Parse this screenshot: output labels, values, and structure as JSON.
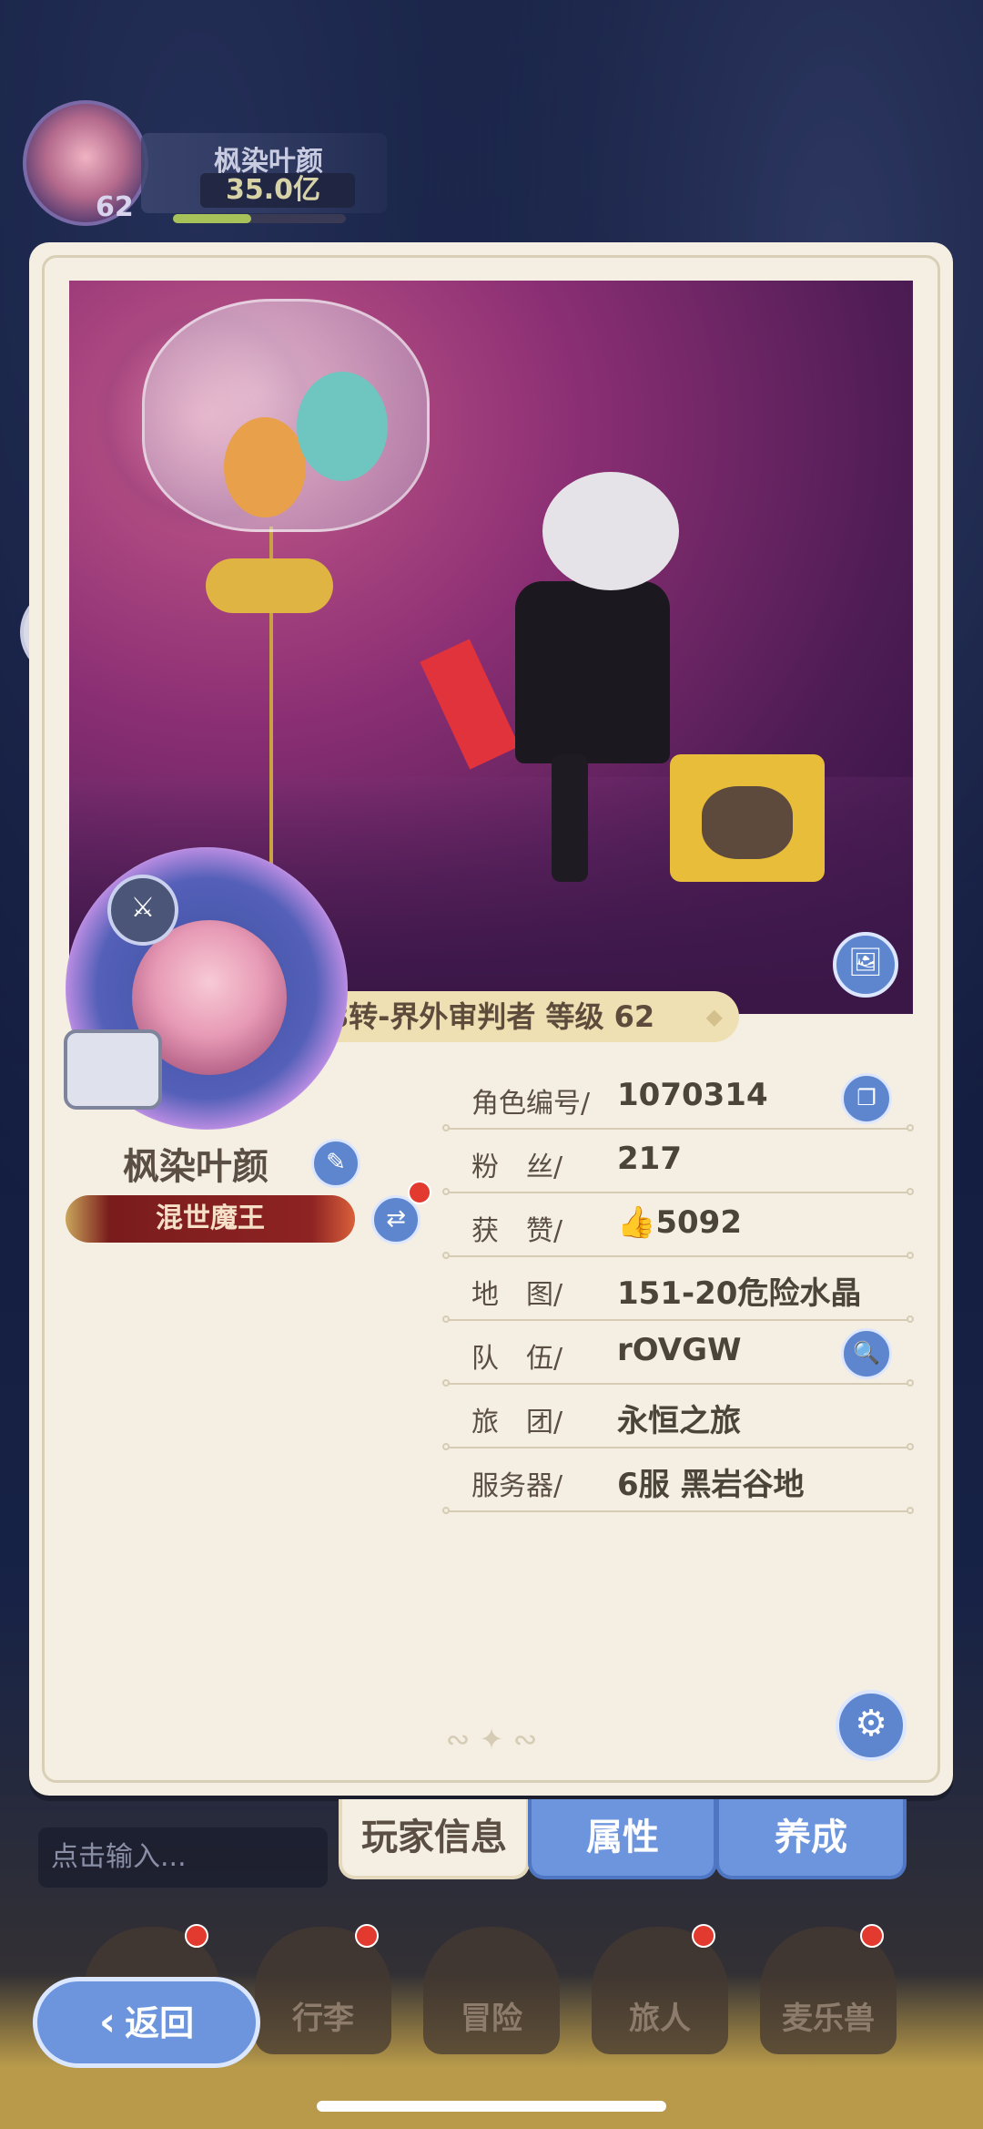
{
  "hud": {
    "name": "枫染叶颜",
    "power": "35.0亿",
    "level": "62",
    "exp_fraction": 0.45
  },
  "profile": {
    "class_banner": "8转-界外审判者 等级 62",
    "player_name": "枫染叶颜",
    "title_badge": "混世魔王"
  },
  "info": {
    "rows": [
      {
        "label": "角色编号/",
        "value": "1070314"
      },
      {
        "label": "粉　丝/",
        "value": "217"
      },
      {
        "label": "获　赞/",
        "value": "5092"
      },
      {
        "label": "地　图/",
        "value": "151-20危险水晶"
      },
      {
        "label": "队　伍/",
        "value": "rOVGW"
      },
      {
        "label": "旅　团/",
        "value": "永恒之旅"
      },
      {
        "label": "服务器/",
        "value": "6服  黑岩谷地"
      }
    ]
  },
  "tabs": [
    "玩家信息",
    "属性",
    "养成"
  ],
  "chat": {
    "placeholder": "点击输入..."
  },
  "nav": {
    "items": [
      "行李",
      "冒险",
      "旅人",
      "麦乐兽"
    ],
    "back": "返回"
  },
  "icons": {
    "thumb": "thumbs-up-icon",
    "search": "search-icon",
    "copy": "copy-icon",
    "settings": "gear-icon",
    "edit": "pencil-icon",
    "swap": "swap-icon",
    "photo": "photo-card-icon"
  },
  "colors": {
    "accent_blue": "#5d86cf",
    "card_bg": "#f4efe2",
    "title_red": "#8e2323"
  }
}
